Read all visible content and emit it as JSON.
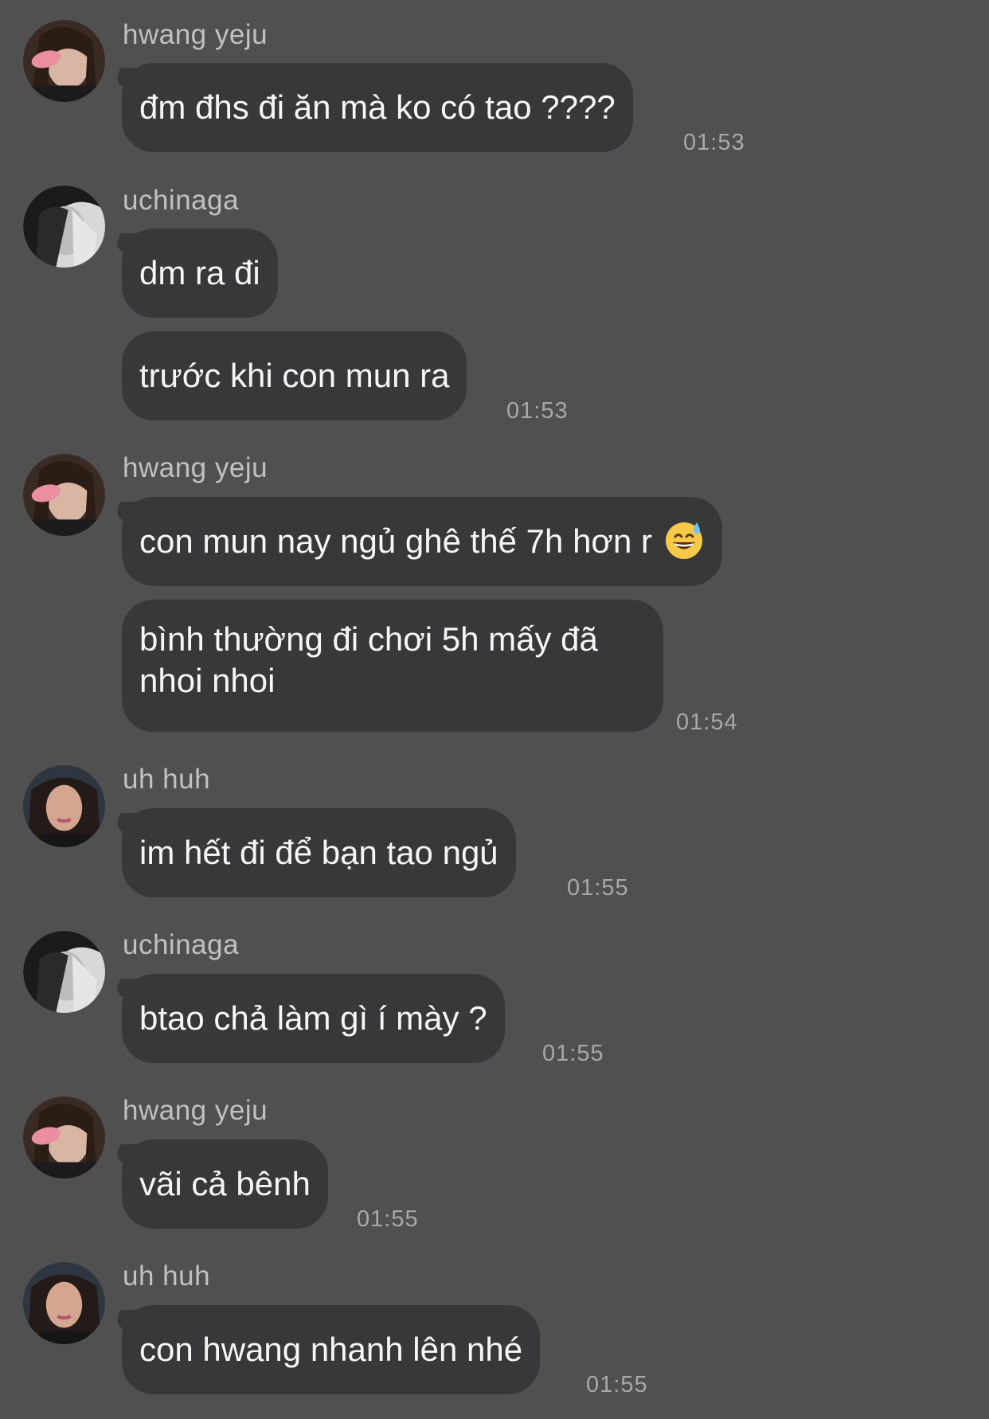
{
  "senders": {
    "hwang": "hwang yeju",
    "uchi": "uchinaga",
    "uh": "uh huh"
  },
  "messages": [
    {
      "text": "đm đhs đi ăn mà ko có tao ????",
      "time": "01:53"
    },
    {
      "text": "dm ra đi"
    },
    {
      "text": "trước khi con mun ra",
      "time": "01:53"
    },
    {
      "text": "con mun nay ngủ ghê thế 7h hơn r",
      "emoji": "sweat-smile-emoji"
    },
    {
      "text": "bình thường đi chơi 5h mấy đã nhoi nhoi",
      "time": "01:54"
    },
    {
      "text": "im hết đi để bạn tao ngủ",
      "time": "01:55"
    },
    {
      "text": "btao chả làm gì í mày ?",
      "time": "01:55"
    },
    {
      "text": "vãi cả bênh",
      "time": "01:55"
    },
    {
      "text": "con hwang nhanh lên nhé",
      "time": "01:55"
    }
  ],
  "colors": {
    "background": "#515051",
    "bubble": "#383739",
    "text": "#f7f6f7",
    "sender": "#c2c1c2",
    "time": "#a9a8a9"
  }
}
